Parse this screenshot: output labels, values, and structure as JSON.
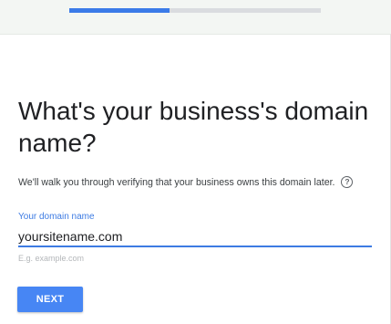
{
  "progress": {
    "fraction": 0.4,
    "fill_color": "#3b7be8",
    "track_color": "#dadcdf"
  },
  "heading": "What's your business's domain name?",
  "subtext": "We'll walk you through verifying that your business owns this domain later.",
  "help_icon": {
    "icon": "help-circle-icon",
    "glyph": "?"
  },
  "domain_field": {
    "label": "Your domain name",
    "value": "yoursitename.com",
    "hint": "E.g. example.com"
  },
  "next_button": {
    "label": "NEXT"
  },
  "colors": {
    "accent": "#3d7be3",
    "button": "#4786f4",
    "header_band": "#f3f6f3"
  }
}
